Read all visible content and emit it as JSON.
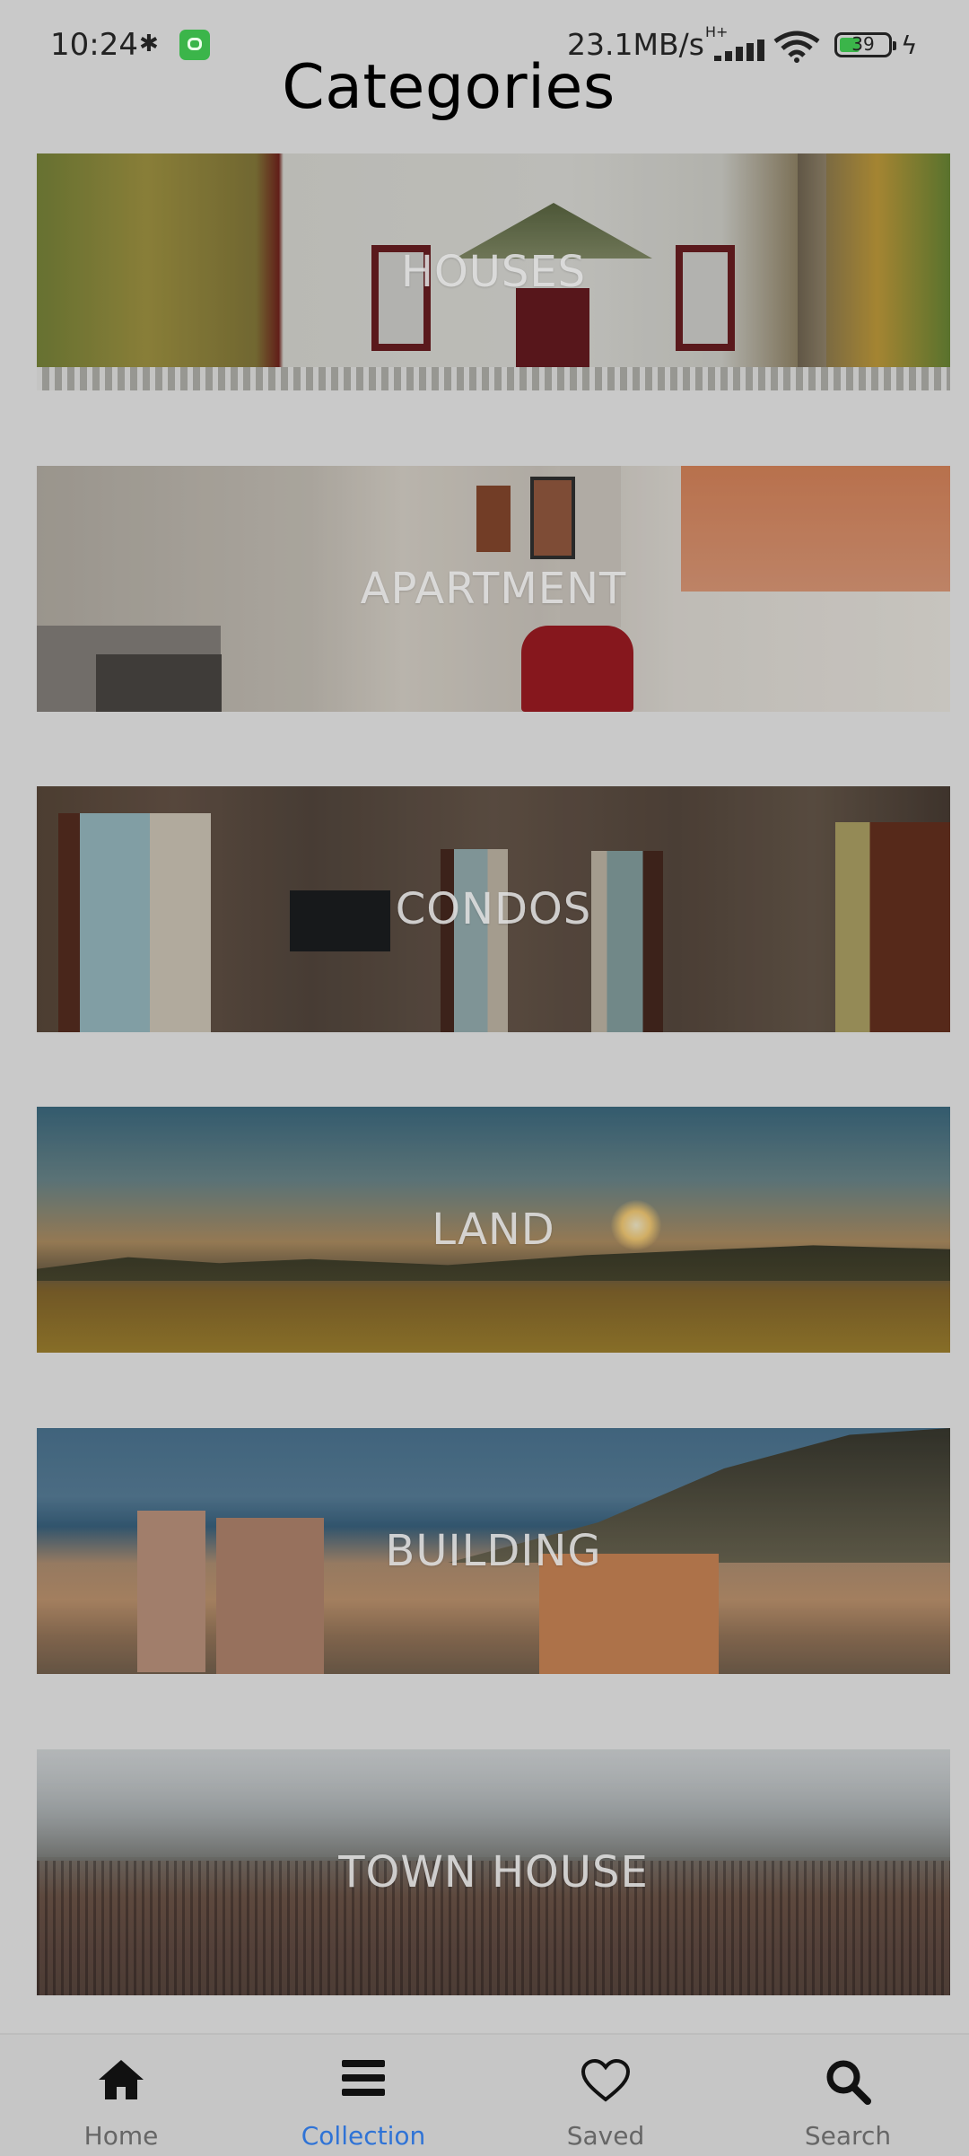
{
  "status_bar": {
    "time": "10:24",
    "network_speed": "23.1MB/s",
    "network_type": "H+",
    "battery": "39",
    "icons": [
      "bluetooth-icon",
      "app-notification-icon",
      "signal-icon",
      "wifi-icon",
      "battery-icon",
      "charging-icon"
    ]
  },
  "page": {
    "title": "Categories"
  },
  "categories": [
    {
      "label": "HOUSES"
    },
    {
      "label": "APARTMENT"
    },
    {
      "label": "CONDOS"
    },
    {
      "label": "LAND"
    },
    {
      "label": "BUILDING"
    },
    {
      "label": "TOWN HOUSE"
    }
  ],
  "bottom_nav": {
    "active_color": "#2f73d6",
    "items": [
      {
        "label": "Home",
        "icon": "home-icon"
      },
      {
        "label": "Collection",
        "icon": "menu-icon",
        "active": true
      },
      {
        "label": "Saved",
        "icon": "heart-icon"
      },
      {
        "label": "Search",
        "icon": "search-icon"
      }
    ]
  }
}
